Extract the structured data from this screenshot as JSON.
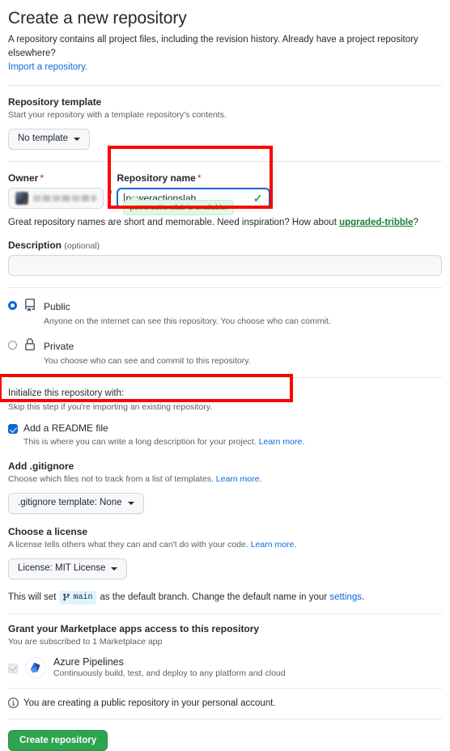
{
  "header": {
    "title": "Create a new repository",
    "subtitle": "A repository contains all project files, including the revision history. Already have a project repository elsewhere?",
    "import_link": "Import a repository."
  },
  "template": {
    "title": "Repository template",
    "note": "Start your repository with a template repository's contents.",
    "button_label": "No template"
  },
  "owner": {
    "label": "Owner",
    "required_mark": "*",
    "separator": "/"
  },
  "repo_name": {
    "label": "Repository name",
    "required_mark": "*",
    "value": "poweractionslab",
    "validity_icon": "check-icon",
    "availability_tooltip": "poweractionslab is available.",
    "hint_prefix": "Great repository names are short and memorable. Need inspiration? How about ",
    "hint_suggestion": "upgraded-tribble",
    "hint_suffix": "?"
  },
  "description": {
    "label": "Description",
    "optional_label": "(optional)",
    "value": "",
    "placeholder": ""
  },
  "visibility": {
    "options": [
      {
        "icon": "repo-icon",
        "title": "Public",
        "description": "Anyone on the internet can see this repository. You choose who can commit.",
        "selected": true
      },
      {
        "icon": "lock-icon",
        "title": "Private",
        "description": "You choose who can see and commit to this repository.",
        "selected": false
      }
    ]
  },
  "initialize": {
    "title": "Initialize this repository with:",
    "note": "Skip this step if you're importing an existing repository.",
    "readme": {
      "checked": true,
      "title": "Add a README file",
      "description": "This is where you can write a long description for your project.",
      "learn_more": "Learn more."
    }
  },
  "gitignore": {
    "title": "Add .gitignore",
    "note": "Choose which files not to track from a list of templates.",
    "learn_more": "Learn more.",
    "button_label": ".gitignore template: None"
  },
  "license": {
    "title": "Choose a license",
    "note": "A license tells others what they can and can't do with your code.",
    "learn_more": "Learn more.",
    "button_label": "License: MIT License"
  },
  "branch": {
    "prefix": "This will set",
    "badge": "main",
    "badge_icon": "git-branch-icon",
    "suffix": "as the default branch. Change the default name in your",
    "settings_link": "settings",
    "period": "."
  },
  "marketplace": {
    "title": "Grant your Marketplace apps access to this repository",
    "note": "You are subscribed to 1 Marketplace app",
    "apps": [
      {
        "icon": "azure-pipelines-icon",
        "name": "Azure Pipelines",
        "description": "Continuously build, test, and deploy to any platform and cloud",
        "checked": true,
        "disabled": true
      }
    ]
  },
  "footer": {
    "info_icon": "info-icon",
    "info_text": "You are creating a public repository in your personal account.",
    "submit_label": "Create repository"
  },
  "annotations": {
    "color": "#ff0000",
    "boxes": [
      {
        "name": "repository-name-highlight"
      },
      {
        "name": "readme-checkbox-highlight"
      }
    ]
  }
}
